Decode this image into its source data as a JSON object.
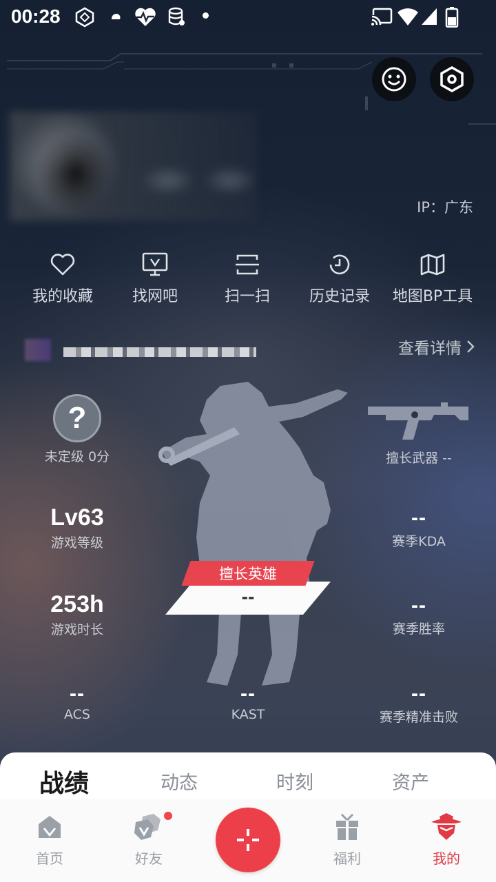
{
  "status_bar": {
    "time": "00:28",
    "icons": [
      "sync-icon",
      "weather-icon",
      "heartbeat-icon",
      "database-icon",
      "dot-icon",
      "cast-icon",
      "wifi-icon",
      "signal-icon",
      "battery-icon"
    ]
  },
  "header": {
    "buttons": [
      "smile-icon",
      "settings-hex-icon"
    ],
    "ip_label": "IP：广东"
  },
  "quick_menu": [
    {
      "label": "我的收藏",
      "icon": "heart-icon"
    },
    {
      "label": "找网吧",
      "icon": "monitor-icon"
    },
    {
      "label": "扫一扫",
      "icon": "scan-icon"
    },
    {
      "label": "历史记录",
      "icon": "history-icon"
    },
    {
      "label": "地图BP工具",
      "icon": "map-icon"
    }
  ],
  "player": {
    "detail_link": "查看详情"
  },
  "stats": {
    "rank": {
      "symbol": "?",
      "label": "未定级 0分"
    },
    "weapon": {
      "label": "擅长武器 --"
    },
    "level": {
      "value": "Lv63",
      "label": "游戏等级"
    },
    "kda": {
      "value": "--",
      "label": "赛季KDA"
    },
    "playtime": {
      "value": "253h",
      "label": "游戏时长"
    },
    "winrate": {
      "value": "--",
      "label": "赛季胜率"
    },
    "hero": {
      "tag": "擅长英雄",
      "value": "--"
    },
    "acs": {
      "value": "--",
      "label": "ACS"
    },
    "kast": {
      "value": "--",
      "label": "KAST"
    },
    "precision": {
      "value": "--",
      "label": "赛季精准击败"
    }
  },
  "tabs": [
    {
      "label": "战绩",
      "active": true
    },
    {
      "label": "动态",
      "active": false
    },
    {
      "label": "时刻",
      "active": false
    },
    {
      "label": "资产",
      "active": false
    }
  ],
  "bottom_nav": [
    {
      "label": "首页",
      "icon": "home-icon"
    },
    {
      "label": "好友",
      "icon": "friends-icon"
    },
    {
      "label": "",
      "icon": "plus-icon"
    },
    {
      "label": "福利",
      "icon": "gift-icon"
    },
    {
      "label": "我的",
      "icon": "agent-icon",
      "active": true
    }
  ],
  "colors": {
    "accent": "#ed3f4a",
    "nav_active": "#e23a45",
    "background": "#1a2538"
  }
}
